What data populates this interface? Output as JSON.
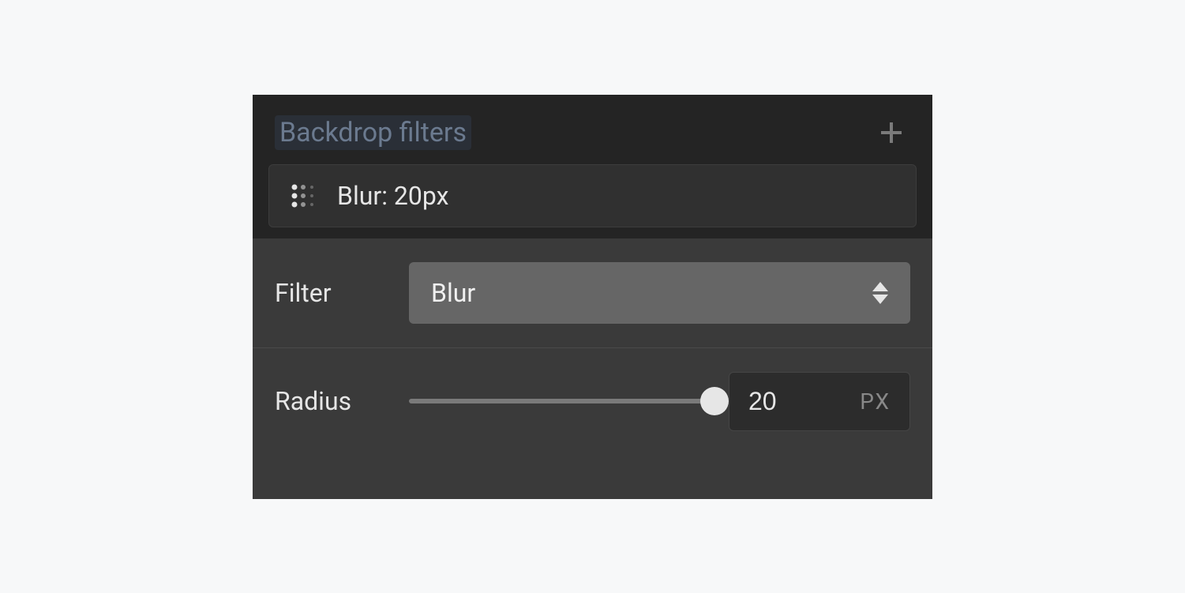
{
  "section": {
    "title": "Backdrop filters"
  },
  "filterItem": {
    "label": "Blur: 20px"
  },
  "filterRow": {
    "label": "Filter",
    "selected": "Blur"
  },
  "radiusRow": {
    "label": "Radius",
    "value": "20",
    "unit": "PX"
  }
}
